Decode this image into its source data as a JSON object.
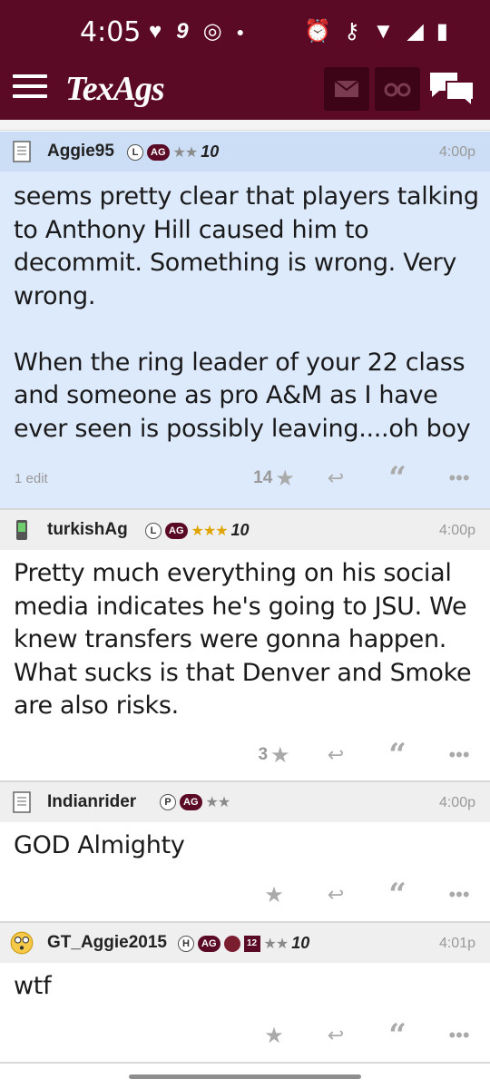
{
  "status": {
    "time": "4:05",
    "notif_count": "9"
  },
  "app": {
    "logo": "TexAgs"
  },
  "posts": [
    {
      "username": "Aggie95",
      "badge_letter": "L",
      "badge_ag": "AG",
      "stars": "★★",
      "ten": "10",
      "time": "4:00p",
      "body": "seems pretty clear that players talking to Anthony Hill caused him to decommit. Something is wrong. Very wrong.\n\nWhen the ring leader of your 22 class and someone as pro A&M as I have ever seen is possibly leaving....oh boy",
      "edit": "1 edit",
      "likes": "14",
      "star_color": "#8a8a8a"
    },
    {
      "username": "turkishAg",
      "badge_letter": "L",
      "badge_ag": "AG",
      "stars": "★★★",
      "ten": "10",
      "time": "4:00p",
      "body": "Pretty much everything on his social media indicates he's going to JSU. We knew transfers were gonna happen. What sucks is that Denver and Smoke are also risks.",
      "likes": "3",
      "star_color": "#e0a400"
    },
    {
      "username": "Indianrider",
      "badge_letter": "P",
      "badge_ag": "AG",
      "stars": "★★",
      "time": "4:00p",
      "body": "GOD Almighty",
      "likes": "",
      "star_color": "#8a8a8a"
    },
    {
      "username": "GT_Aggie2015",
      "badge_letter": "H",
      "badge_ag": "AG",
      "stars": "★★",
      "ten": "10",
      "twelve": "12",
      "time": "4:01p",
      "body": "wtf",
      "likes": "",
      "star_color": "#8a8a8a"
    }
  ],
  "colors": {
    "maroon": "#5b0a26",
    "highlight": "#ddeafc"
  }
}
